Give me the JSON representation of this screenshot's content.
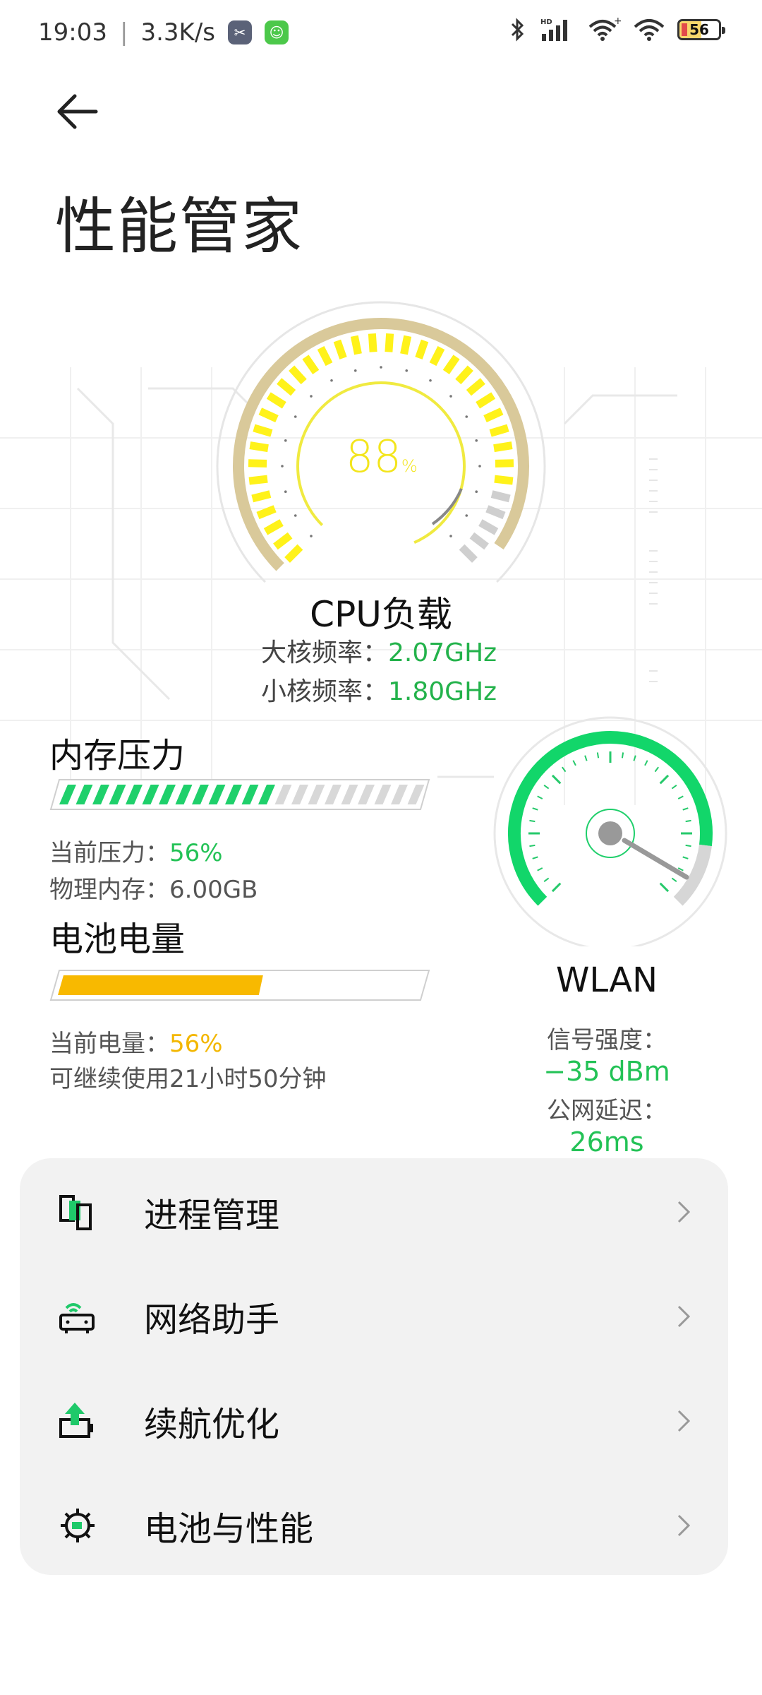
{
  "status_bar": {
    "time": "19:03",
    "speed": "3.3K/s",
    "battery_level": "56"
  },
  "header": {
    "title": "性能管家"
  },
  "cpu": {
    "load_value": "88",
    "load_unit": "%",
    "title": "CPU负载",
    "big_core_label": "大核频率：",
    "big_core_value": "2.07GHz",
    "small_core_label": "小核频率：",
    "small_core_value": "1.80GHz"
  },
  "memory": {
    "title": "内存压力",
    "pressure_label": "当前压力：",
    "pressure_value": "56%",
    "physical_label": "物理内存：",
    "physical_value": "6.00GB",
    "fill_fraction": 0.56
  },
  "battery": {
    "title": "电池电量",
    "level_label": "当前电量：",
    "level_value": "56%",
    "remaining_text": "可继续使用21小时50分钟",
    "fill_fraction": 0.56
  },
  "wlan": {
    "title": "WLAN",
    "signal_label": "信号强度：",
    "signal_value": "−35 dBm",
    "latency_label": "公网延迟：",
    "latency_value": "26ms"
  },
  "menu": {
    "items": [
      {
        "label": "进程管理",
        "icon": "process-icon"
      },
      {
        "label": "网络助手",
        "icon": "network-icon"
      },
      {
        "label": "续航优化",
        "icon": "battery-boost-icon"
      },
      {
        "label": "电池与性能",
        "icon": "gear-icon"
      }
    ]
  },
  "colors": {
    "accent_green": "#23c256",
    "accent_yellow": "#f3e51c",
    "battery_orange": "#f8b900"
  }
}
